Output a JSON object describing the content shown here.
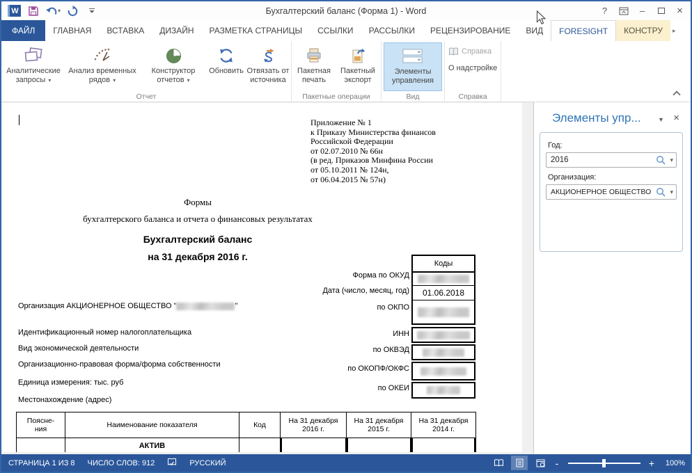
{
  "colors": {
    "accent": "#2B579A",
    "contextual_tab_bg": "#FBF1CF",
    "selected_button_bg": "#C9E2F6",
    "status_bg": "#2B579A",
    "pane_title": "#2E75B6"
  },
  "icons": {
    "word_logo": "W",
    "caret_down": "▾",
    "scroll_right": "▸",
    "help": "?",
    "minimize": "–",
    "close": "×"
  },
  "titlebar": {
    "title": "Бухгалтерский баланс (Форма 1) - Word"
  },
  "tabs": [
    "ФАЙЛ",
    "ГЛАВНАЯ",
    "ВСТАВКА",
    "ДИЗАЙН",
    "РАЗМЕТКА СТРАНИЦЫ",
    "ССЫЛКИ",
    "РАССЫЛКИ",
    "РЕЦЕНЗИРОВАНИЕ",
    "ВИД",
    "FORESIGHT",
    "КОНСТРУ"
  ],
  "ribbon": {
    "groups": [
      {
        "label": "Отчет"
      },
      {
        "label": "Пакетные операции"
      },
      {
        "label": "Вид"
      },
      {
        "label": "Справка"
      }
    ],
    "buttons": {
      "analytic": "Аналитические\nзапросы",
      "timeseries": "Анализ временных\nрядов",
      "designer": "Конструктор\nотчетов",
      "refresh": "Обновить",
      "unlink": "Отвязать от\nисточника",
      "batch_print": "Пакетная\nпечать",
      "batch_export": "Пакетный\nэкспорт",
      "controls": "Элементы\nуправления",
      "help": "Справка",
      "about": "О надстройке"
    }
  },
  "document": {
    "legal": "Приложение № 1\nк Приказу Министерства финансов\nРоссийской Федерации\nот 02.07.2010 № 66н\n(в ред. Приказов Минфина России\nот 05.10.2011 № 124н,\nот 06.04.2015 № 57н)",
    "forms_heading": "Формы",
    "forms_subheading": "бухгалтерского баланса и отчета о финансовых результатах",
    "balance_title": "Бухгалтерский баланс",
    "balance_date": "на 31 декабря 2016 г.",
    "codes_header": "Коды",
    "date_value": "01.06.2018",
    "label_okud": "Форма по ОКУД",
    "label_date": "Дата (число, месяц, год)",
    "label_okpo": "по ОКПО",
    "label_inn": "ИНН",
    "label_okved": "по ОКВЭД",
    "label_okopf": "по ОКОПФ/ОКФС",
    "label_okei": "по ОКЕИ",
    "org_prefix": "Организация АКЦИОНЕРНОЕ ОБЩЕСТВО \"",
    "org_suffix": "\"",
    "label_taxpayer": "Идентификационный номер налогоплательщика",
    "label_activity": "Вид экономической деятельности",
    "label_legalform": "Организационно-правовая форма/форма собственности",
    "label_unit": "Единица измерения: тыс. руб",
    "label_address": "Местонахождение (адрес)",
    "table": {
      "headers": [
        "Поясне-\nния",
        "Наименование показателя",
        "Код",
        "На 31 декабря\n2016 г.",
        "На 31 декабря\n2015 г.",
        "На 31 декабря\n2014 г."
      ],
      "row1": "АКТИВ"
    }
  },
  "panel": {
    "title": "Элементы упр...",
    "year_label": "Год:",
    "year_value": "2016",
    "org_label": "Организация:",
    "org_value": "АКЦИОНЕРНОЕ ОБЩЕСТВО"
  },
  "statusbar": {
    "page": "СТРАНИЦА 1 ИЗ 8",
    "words": "ЧИСЛО СЛОВ: 912",
    "language": "РУССКИЙ",
    "zoom": "100%",
    "zoom_minus": "-",
    "zoom_plus": "+"
  }
}
